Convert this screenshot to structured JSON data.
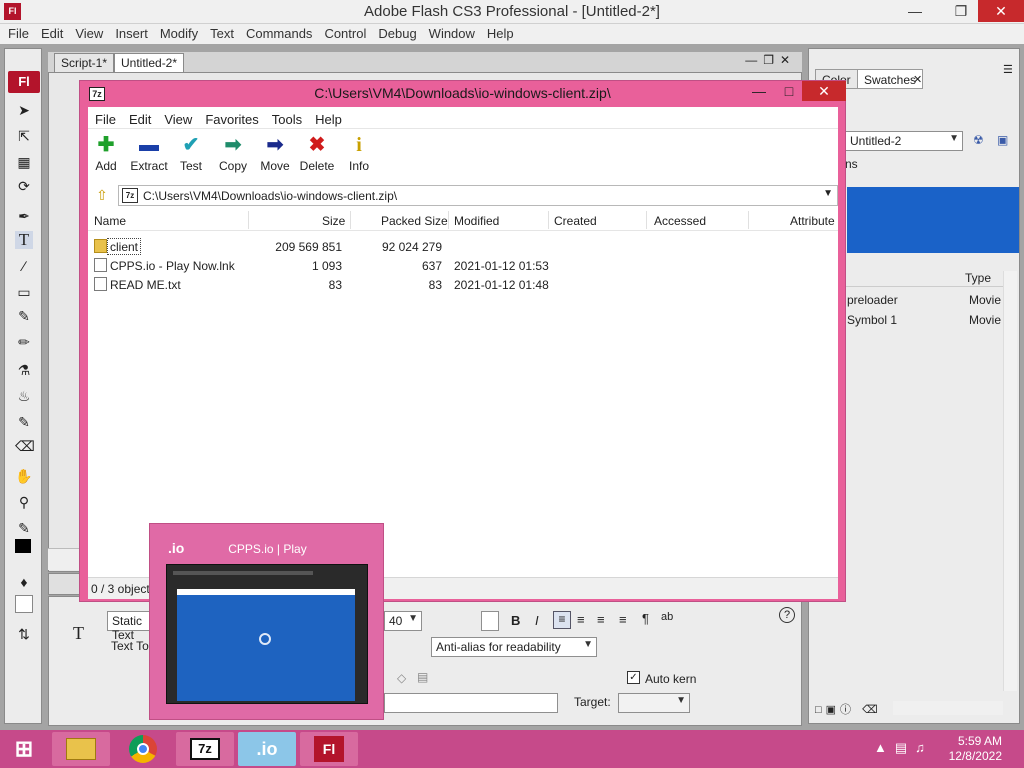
{
  "flash": {
    "logo": "Fl",
    "title": "Adobe Flash CS3 Professional - [Untitled-2*]",
    "menu": [
      "File",
      "Edit",
      "View",
      "Insert",
      "Modify",
      "Text",
      "Commands",
      "Control",
      "Debug",
      "Window",
      "Help"
    ],
    "doc_tabs": [
      "Script-1*",
      "Untitled-2*"
    ],
    "status_text": "0 / 3 objects",
    "props": {
      "text_type": "Static Text",
      "text_tool": "Text Tool",
      "font_size": "40",
      "anti_alias": "Anti-alias for readability",
      "auto_kern_label": "Auto kern",
      "target_label": "Target:"
    },
    "right_panel": {
      "tabs": [
        "Color",
        "Swatches"
      ],
      "doc_select": "Untitled-2",
      "library_header": "Type",
      "library_items": [
        {
          "name": "preloader",
          "type": "Movie"
        },
        {
          "name": "Symbol 1",
          "type": "Movie"
        }
      ],
      "items_label": "ns"
    }
  },
  "zip": {
    "title": "C:\\Users\\VM4\\Downloads\\io-windows-client.zip\\",
    "menu": [
      "File",
      "Edit",
      "View",
      "Favorites",
      "Tools",
      "Help"
    ],
    "toolbar": [
      {
        "label": "Add",
        "icon": "plus-icon",
        "color": "#1fa02b"
      },
      {
        "label": "Extract",
        "icon": "minus-icon",
        "color": "#1a3fa8"
      },
      {
        "label": "Test",
        "icon": "check-icon",
        "color": "#1fa0b4"
      },
      {
        "label": "Copy",
        "icon": "double-arrow-icon",
        "color": "#1f8c6b"
      },
      {
        "label": "Move",
        "icon": "arrow-icon",
        "color": "#1a2a8c"
      },
      {
        "label": "Delete",
        "icon": "x-icon",
        "color": "#d01c1c"
      },
      {
        "label": "Info",
        "icon": "info-icon",
        "color": "#c8a000"
      }
    ],
    "address": "C:\\Users\\VM4\\Downloads\\io-windows-client.zip\\",
    "columns": [
      "Name",
      "Size",
      "Packed Size",
      "Modified",
      "Created",
      "Accessed",
      "Attribute"
    ],
    "rows": [
      {
        "name": "client",
        "size": "209 569 851",
        "packed": "92 024 279",
        "modified": "",
        "kind": "folder"
      },
      {
        "name": "CPPS.io - Play Now.lnk",
        "size": "1 093",
        "packed": "637",
        "modified": "2021-01-12 01:53",
        "kind": "file"
      },
      {
        "name": "READ ME.txt",
        "size": "83",
        "packed": "83",
        "modified": "2021-01-12 01:48",
        "kind": "file"
      }
    ]
  },
  "thumbnail": {
    "app_mark": ".io",
    "title": "CPPS.io | Play"
  },
  "taskbar": {
    "apps": [
      "file-explorer",
      "chrome",
      "7-zip",
      "io-client",
      "flash"
    ],
    "zip_label": "7z",
    "io_label": ".io",
    "flash_label": "Fl",
    "time": "5:59 AM",
    "date": "12/8/2022"
  },
  "colors": {
    "window_accent": "#e9609a",
    "taskbar": "#c64a8a",
    "flash_red": "#b3142b"
  }
}
